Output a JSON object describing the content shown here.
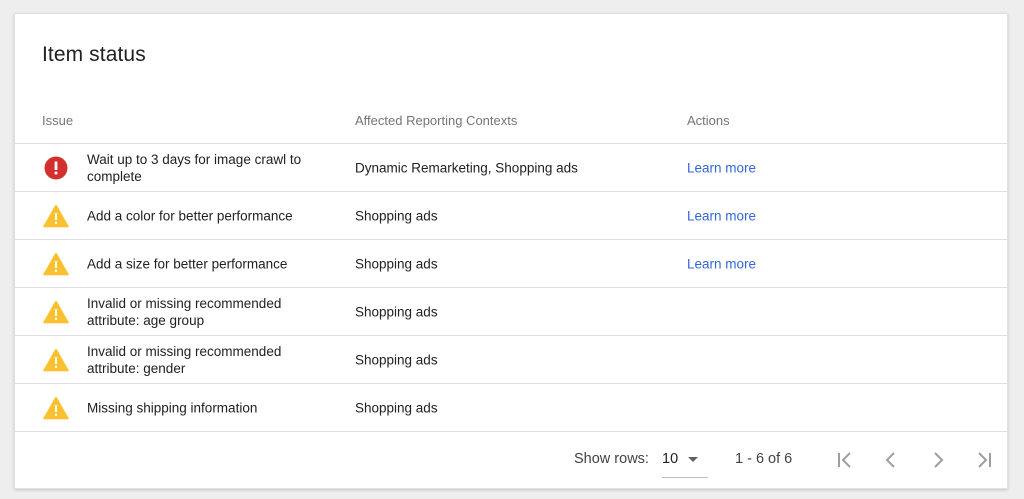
{
  "card": {
    "title": "Item status"
  },
  "table": {
    "headers": {
      "issue": "Issue",
      "contexts": "Affected Reporting Contexts",
      "actions": "Actions"
    },
    "rows": [
      {
        "severity": "error",
        "icon": "error-icon",
        "issue": "Wait up to 3 days for image crawl to complete",
        "contexts": "Dynamic Remarketing, Shopping ads",
        "action": "Learn more"
      },
      {
        "severity": "warning",
        "icon": "warning-icon",
        "issue": "Add a color for better performance",
        "contexts": "Shopping ads",
        "action": "Learn more"
      },
      {
        "severity": "warning",
        "icon": "warning-icon",
        "issue": "Add a size for better performance",
        "contexts": "Shopping ads",
        "action": "Learn more"
      },
      {
        "severity": "warning",
        "icon": "warning-icon",
        "issue": "Invalid or missing recommended attribute: age group",
        "contexts": "Shopping ads",
        "action": ""
      },
      {
        "severity": "warning",
        "icon": "warning-icon",
        "issue": "Invalid or missing recommended attribute: gender",
        "contexts": "Shopping ads",
        "action": ""
      },
      {
        "severity": "warning",
        "icon": "warning-icon",
        "issue": "Missing shipping information",
        "contexts": "Shopping ads",
        "action": ""
      }
    ]
  },
  "pagination": {
    "show_rows_label": "Show rows:",
    "rows_per_page": "10",
    "range": "1 - 6 of 6",
    "first_icon": "first-page-icon",
    "prev_icon": "chevron-left-icon",
    "next_icon": "chevron-right-icon",
    "last_icon": "last-page-icon"
  },
  "colors": {
    "error": "#d32f2f",
    "warning": "#fbc02d",
    "link": "#3367d6",
    "nav_icon": "#9e9e9e"
  }
}
